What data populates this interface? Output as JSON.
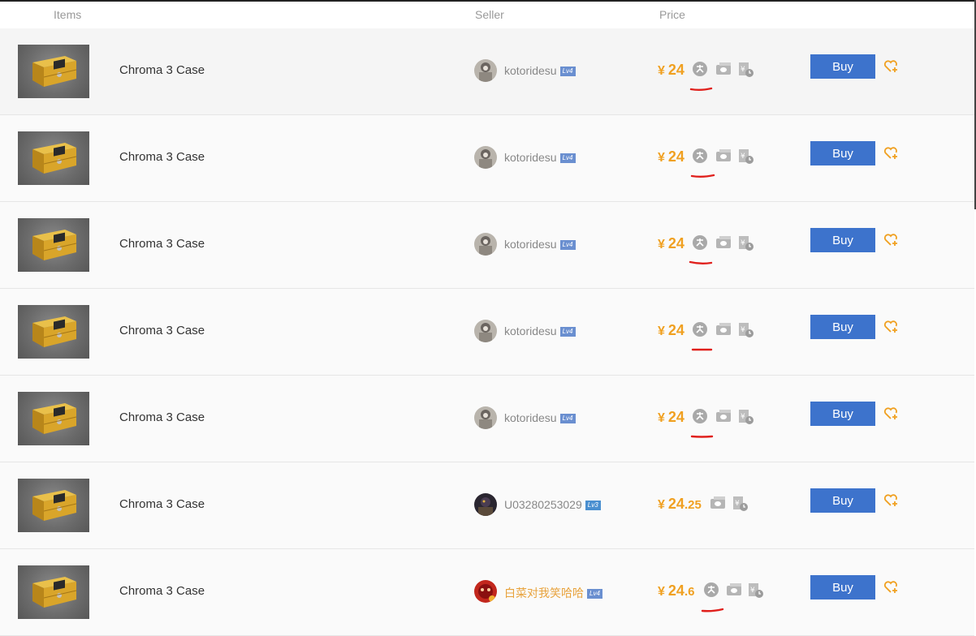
{
  "header": {
    "items": "Items",
    "seller": "Seller",
    "price": "Price"
  },
  "rows": [
    {
      "name": "Chroma 3 Case",
      "seller": "kotoridesu",
      "level": "Lv4",
      "price_int": "24",
      "price_dec": "",
      "currency": "¥",
      "buy": "Buy"
    },
    {
      "name": "Chroma 3 Case",
      "seller": "kotoridesu",
      "level": "Lv4",
      "price_int": "24",
      "price_dec": "",
      "currency": "¥",
      "buy": "Buy"
    },
    {
      "name": "Chroma 3 Case",
      "seller": "kotoridesu",
      "level": "Lv4",
      "price_int": "24",
      "price_dec": "",
      "currency": "¥",
      "buy": "Buy"
    },
    {
      "name": "Chroma 3 Case",
      "seller": "kotoridesu",
      "level": "Lv4",
      "price_int": "24",
      "price_dec": "",
      "currency": "¥",
      "buy": "Buy"
    },
    {
      "name": "Chroma 3 Case",
      "seller": "kotoridesu",
      "level": "Lv4",
      "price_int": "24",
      "price_dec": "",
      "currency": "¥",
      "buy": "Buy"
    },
    {
      "name": "Chroma 3 Case",
      "seller": "U03280253029",
      "level": "Lv3",
      "price_int": "24",
      "price_dec": ".25",
      "currency": "¥",
      "buy": "Buy"
    },
    {
      "name": "Chroma 3 Case",
      "seller": "白菜对我笑哈哈",
      "level": "Lv4",
      "price_int": "24",
      "price_dec": ".6",
      "currency": "¥",
      "buy": "Buy"
    }
  ],
  "colors": {
    "price": "#f0a020",
    "buy_button": "#3d73cc",
    "annotation": "#e0201c",
    "seller_highlight": "#e8a33d"
  },
  "icons": [
    "item-thumbnail",
    "seller-avatar",
    "alipay-icon",
    "wechat-pay-icon",
    "delayed-payment-icon",
    "favorite-heart-icon"
  ]
}
